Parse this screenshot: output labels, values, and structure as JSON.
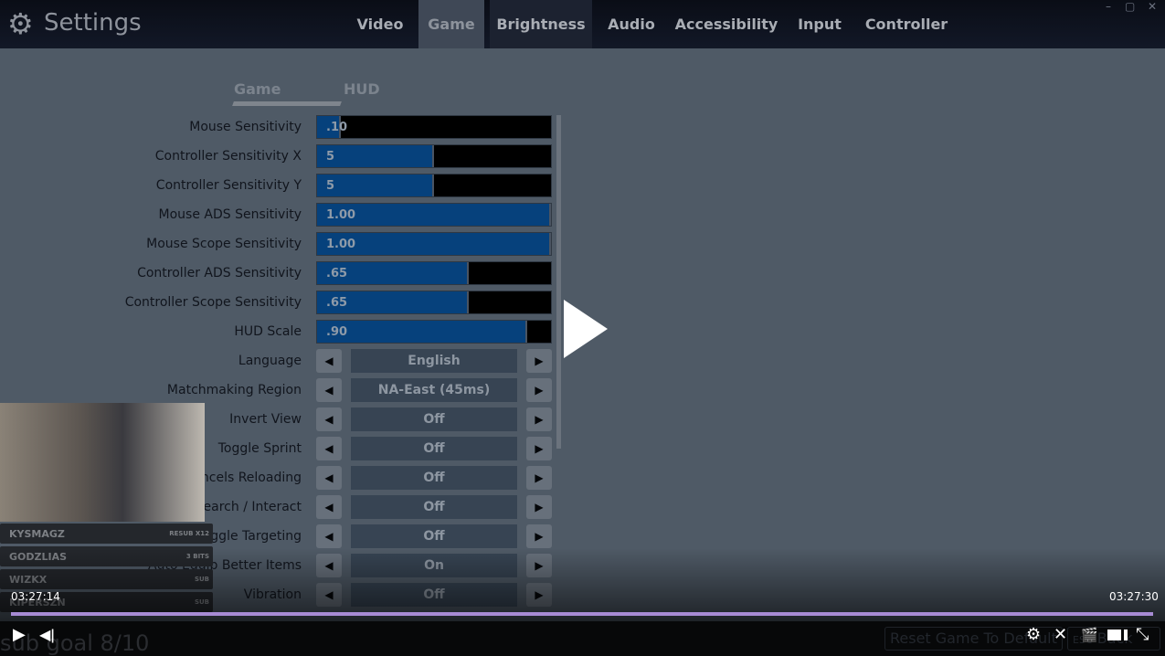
{
  "header": {
    "title": "Settings",
    "icon": "gear-icon",
    "tabs": [
      "Video",
      "Game",
      "Brightness",
      "Audio",
      "Accessibility",
      "Input",
      "Controller"
    ],
    "active_tab": "Game"
  },
  "window_controls": {
    "minimize": "–",
    "restore": "▢",
    "close": "✕"
  },
  "subtabs": [
    "Game",
    "HUD"
  ],
  "sliders": [
    {
      "label": "Mouse Sensitivity",
      "value": ".10",
      "fraction": 0.1
    },
    {
      "label": "Controller Sensitivity X",
      "value": "5",
      "fraction": 0.5
    },
    {
      "label": "Controller Sensitivity Y",
      "value": "5",
      "fraction": 0.5
    },
    {
      "label": "Mouse ADS Sensitivity",
      "value": "1.00",
      "fraction": 1.0
    },
    {
      "label": "Mouse Scope Sensitivity",
      "value": "1.00",
      "fraction": 1.0
    },
    {
      "label": "Controller ADS Sensitivity",
      "value": ".65",
      "fraction": 0.65
    },
    {
      "label": "Controller Scope Sensitivity",
      "value": ".65",
      "fraction": 0.65
    },
    {
      "label": "HUD Scale",
      "value": ".90",
      "fraction": 0.9
    }
  ],
  "selectors": [
    {
      "label": "Language",
      "value": "English"
    },
    {
      "label": "Matchmaking Region",
      "value": "NA-East (45ms)"
    },
    {
      "label": "Invert View",
      "value": "Off"
    },
    {
      "label": "Toggle Sprint",
      "value": "Off"
    },
    {
      "label": "ancels Reloading",
      "value": "Off"
    },
    {
      "label": "earch / Interact",
      "value": "Off"
    },
    {
      "label": "ggle Targeting",
      "value": "Off"
    },
    {
      "label": "Auto Equip Better Items",
      "value": "On"
    },
    {
      "label": "Vibration",
      "value": "Off"
    }
  ],
  "alerts": [
    {
      "name": "KYSMAGZ",
      "type": "RESUB X12"
    },
    {
      "name": "GODZLIAS",
      "type": "3 BITS"
    },
    {
      "name": "WIZKX",
      "type": "SUB"
    },
    {
      "name": "KIPERSZN",
      "type": "SUB"
    }
  ],
  "player": {
    "current_time": "03:27:14",
    "end_time": "03:27:30",
    "progress": 0.99,
    "accent": "#a78bd4"
  },
  "overlay": {
    "sub_goal": "sub goal 8/10"
  },
  "footer": {
    "reset": "Reset Game To Default",
    "back_key": "ESC",
    "back": "Back"
  }
}
